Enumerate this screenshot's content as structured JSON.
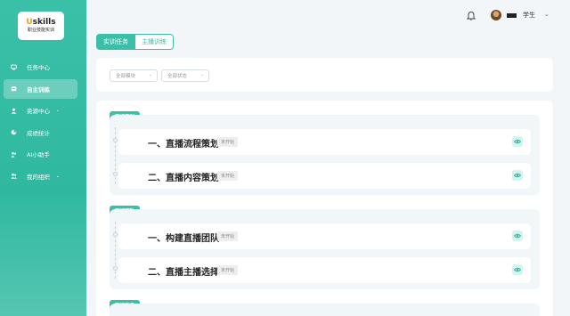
{
  "brand": {
    "logo_mark": "skills",
    "logo_prefix": "U",
    "logo_sub": "职业技能实训"
  },
  "sidebar": {
    "items": [
      {
        "label": "任务中心",
        "icon": "monitor-icon",
        "active": false,
        "has_caret": false
      },
      {
        "label": "自主训练",
        "icon": "calendar-icon",
        "active": true,
        "has_caret": false
      },
      {
        "label": "资源中心",
        "icon": "user-icon",
        "active": false,
        "has_caret": true
      },
      {
        "label": "成绩统计",
        "icon": "pie-chart-icon",
        "active": false,
        "has_caret": false
      },
      {
        "label": "AI小助手",
        "icon": "assistant-icon",
        "active": false,
        "has_caret": false
      },
      {
        "label": "我的组织",
        "icon": "group-icon",
        "active": false,
        "has_caret": true
      }
    ]
  },
  "header": {
    "user_name": "学生",
    "caret": "⌄"
  },
  "tabs": [
    {
      "label": "实训任务",
      "active": true
    },
    {
      "label": "主播训练",
      "active": false
    }
  ],
  "filters": {
    "module_placeholder": "全部模块",
    "status_placeholder": "全部状态"
  },
  "groups": [
    {
      "label": "直播策划",
      "items": [
        {
          "title": "一、直播流程策划",
          "status": "未开始"
        },
        {
          "title": "二、直播内容策划",
          "status": "未开始"
        }
      ]
    },
    {
      "label": "直播团队",
      "items": [
        {
          "title": "一、构建直播团队",
          "status": "未开始"
        },
        {
          "title": "二、直播主播选择",
          "status": "未开始"
        }
      ]
    },
    {
      "label": "直播商品",
      "items": []
    }
  ],
  "colors": {
    "accent": "#3bbfa8",
    "sidebar_bg": "#34bba3",
    "eye_bg": "#d6f2ef"
  }
}
